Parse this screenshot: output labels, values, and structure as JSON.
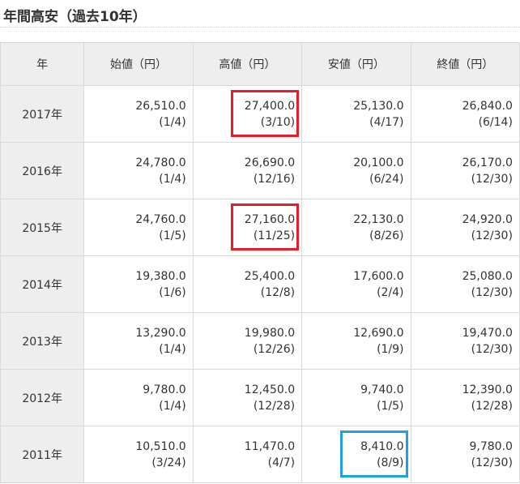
{
  "page": {
    "title": "年間高安（過去10年）"
  },
  "table": {
    "headers": [
      "年",
      "始値（円）",
      "高値（円）",
      "安値（円）",
      "終値（円）"
    ],
    "rows": [
      {
        "year": "2017年",
        "open": {
          "value": "26,510.0",
          "date": "(1/4)"
        },
        "high": {
          "value": "27,400.0",
          "date": "(3/10)"
        },
        "low": {
          "value": "25,130.0",
          "date": "(4/17)"
        },
        "close": {
          "value": "26,840.0",
          "date": "(6/14)"
        }
      },
      {
        "year": "2016年",
        "open": {
          "value": "24,780.0",
          "date": "(1/4)"
        },
        "high": {
          "value": "26,690.0",
          "date": "(12/16)"
        },
        "low": {
          "value": "20,100.0",
          "date": "(6/24)"
        },
        "close": {
          "value": "26,170.0",
          "date": "(12/30)"
        }
      },
      {
        "year": "2015年",
        "open": {
          "value": "24,760.0",
          "date": "(1/5)"
        },
        "high": {
          "value": "27,160.0",
          "date": "(11/25)"
        },
        "low": {
          "value": "22,130.0",
          "date": "(8/26)"
        },
        "close": {
          "value": "24,920.0",
          "date": "(12/30)"
        }
      },
      {
        "year": "2014年",
        "open": {
          "value": "19,380.0",
          "date": "(1/6)"
        },
        "high": {
          "value": "25,400.0",
          "date": "(12/8)"
        },
        "low": {
          "value": "17,600.0",
          "date": "(2/4)"
        },
        "close": {
          "value": "25,080.0",
          "date": "(12/30)"
        }
      },
      {
        "year": "2013年",
        "open": {
          "value": "13,290.0",
          "date": "(1/4)"
        },
        "high": {
          "value": "19,980.0",
          "date": "(12/26)"
        },
        "low": {
          "value": "12,690.0",
          "date": "(1/9)"
        },
        "close": {
          "value": "19,470.0",
          "date": "(12/30)"
        }
      },
      {
        "year": "2012年",
        "open": {
          "value": "9,780.0",
          "date": "(1/4)"
        },
        "high": {
          "value": "12,450.0",
          "date": "(12/28)"
        },
        "low": {
          "value": "9,740.0",
          "date": "(1/5)"
        },
        "close": {
          "value": "12,390.0",
          "date": "(12/28)"
        }
      },
      {
        "year": "2011年",
        "open": {
          "value": "10,510.0",
          "date": "(3/24)"
        },
        "high": {
          "value": "11,470.0",
          "date": "(4/7)"
        },
        "low": {
          "value": "8,410.0",
          "date": "(8/9)"
        },
        "close": {
          "value": "9,780.0",
          "date": "(12/30)"
        }
      }
    ]
  },
  "highlights": {
    "red_color": "#e31d2c",
    "blue_color": "#1da1e0"
  }
}
